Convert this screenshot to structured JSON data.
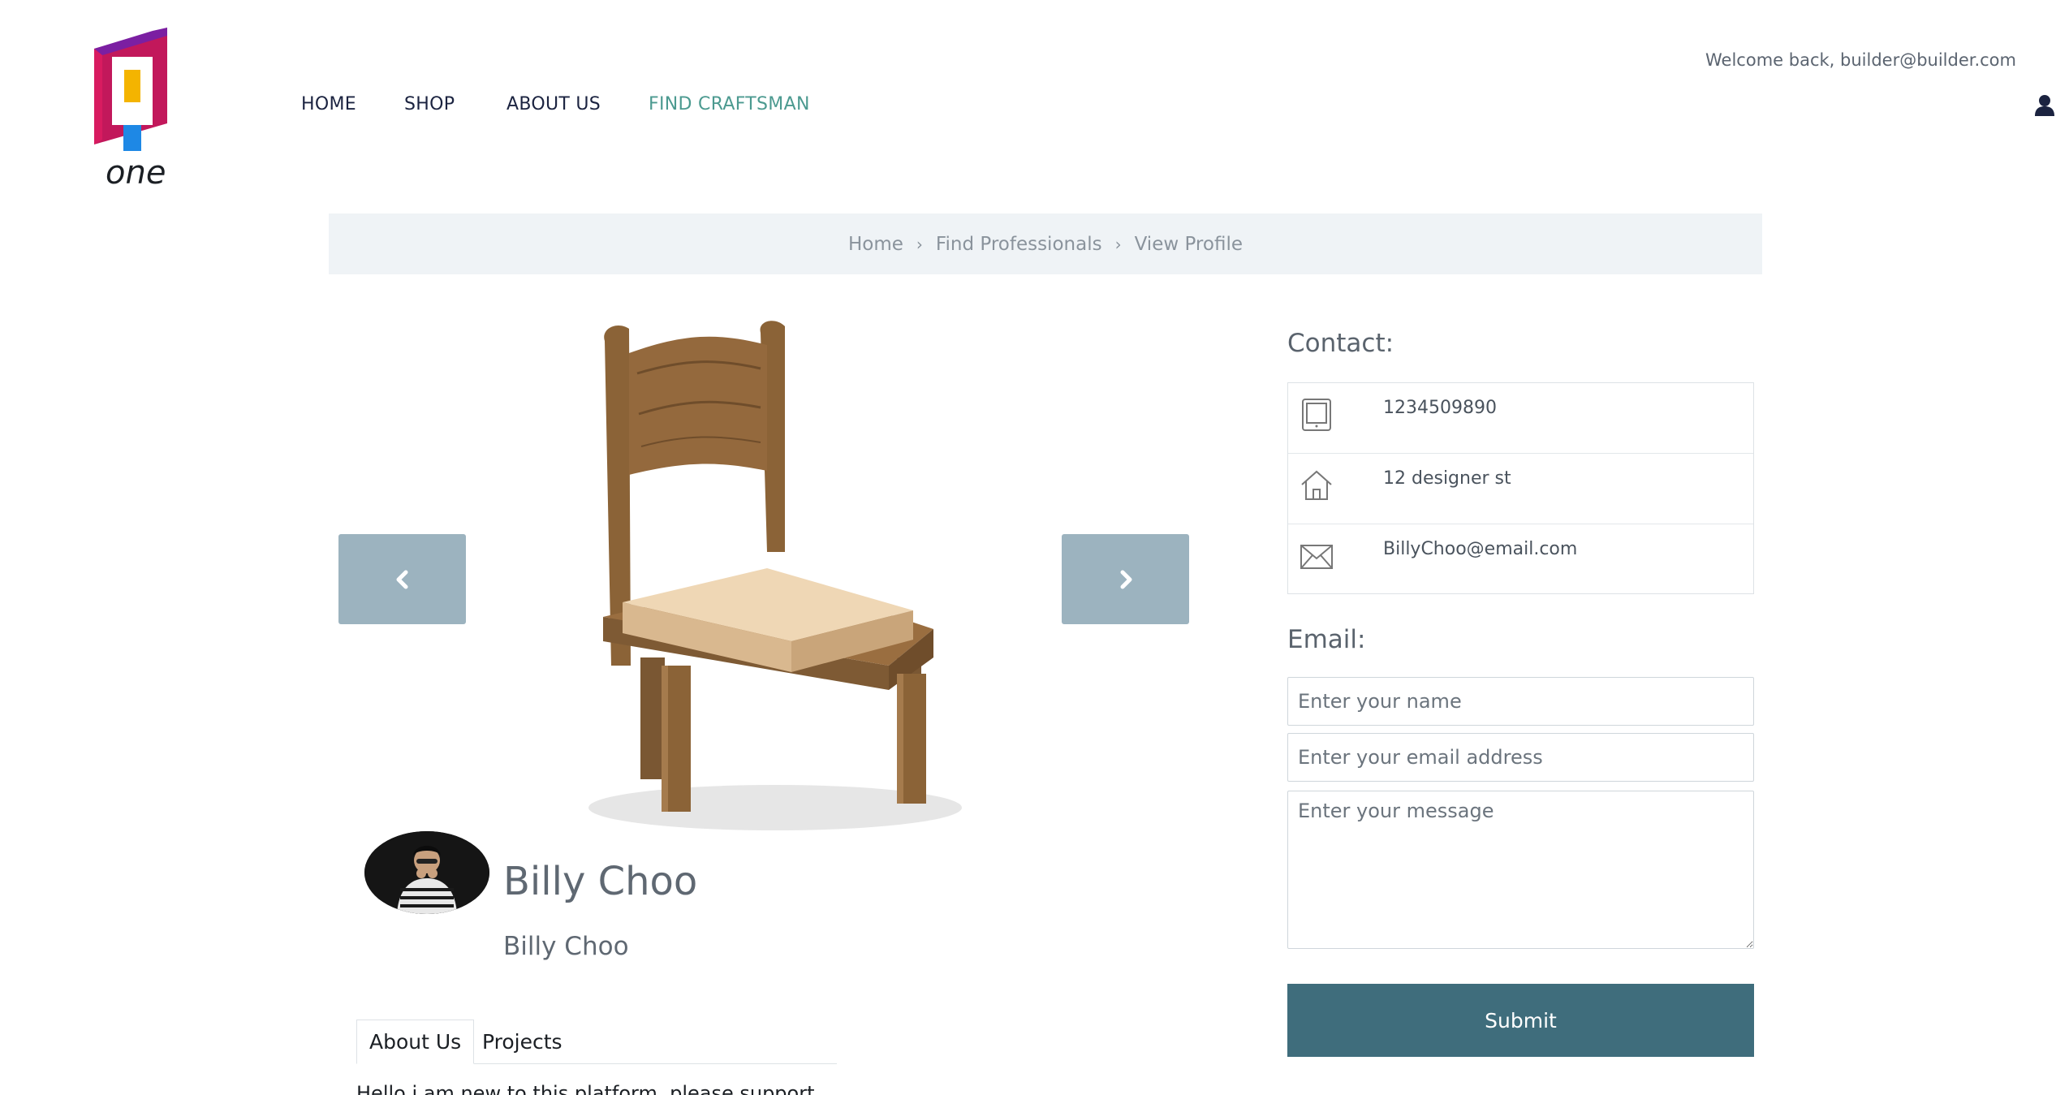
{
  "header": {
    "logo_text": "one",
    "nav": [
      {
        "label": "HOME",
        "active": false
      },
      {
        "label": "SHOP",
        "active": false
      },
      {
        "label": "ABOUT US",
        "active": false
      },
      {
        "label": "FIND CRAFTSMAN",
        "active": true
      }
    ],
    "welcome": "Welcome back, builder@builder.com"
  },
  "breadcrumb": [
    "Home",
    "Find Professionals",
    "View Profile"
  ],
  "profile": {
    "name": "Billy Choo",
    "subtitle": "Billy Choo"
  },
  "tabs": [
    {
      "label": "About Us",
      "active": true
    },
    {
      "label": "Projects",
      "active": false
    }
  ],
  "about_text": "Hello i am new to this platform, please support",
  "contact": {
    "title": "Contact:",
    "phone": "1234509890",
    "address": "12 designer st",
    "email": "BillyChoo@email.com"
  },
  "email_form": {
    "title": "Email:",
    "name_placeholder": "Enter your name",
    "email_placeholder": "Enter your email address",
    "message_placeholder": "Enter your message",
    "submit_label": "Submit"
  },
  "colors": {
    "accent": "#4c9a90",
    "button": "#3f6d7c",
    "carousel_button": "#9cb3bf",
    "breadcrumb_bg": "#eff3f6"
  }
}
